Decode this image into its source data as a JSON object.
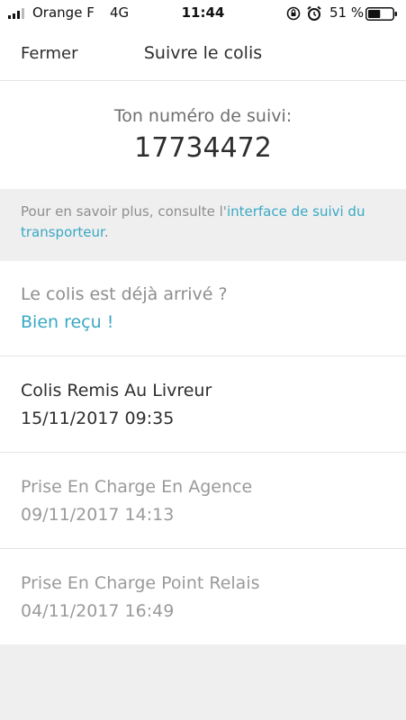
{
  "status_bar": {
    "carrier": "Orange F",
    "network": "4G",
    "time": "11:44",
    "battery_percent": "51 %",
    "battery_level": 0.51,
    "icons": [
      "signal-icon",
      "rotation-lock-icon",
      "alarm-icon",
      "battery-icon"
    ]
  },
  "nav": {
    "close_label": "Fermer",
    "title": "Suivre le colis"
  },
  "tracking": {
    "label": "Ton numéro de suivi:",
    "number": "17734472"
  },
  "info": {
    "text_before": "Pour en savoir plus, consulte l'",
    "link_text": "interface de suivi du transporteur",
    "text_after": "."
  },
  "received": {
    "question": "Le colis est déjà arrivé ?",
    "action_label": "Bien reçu !"
  },
  "events": [
    {
      "status": "Colis Remis Au Livreur",
      "date": "15/11/2017 09:35",
      "state": "current"
    },
    {
      "status": "Prise En Charge En Agence",
      "date": "09/11/2017 14:13",
      "state": "past"
    },
    {
      "status": "Prise En Charge Point Relais",
      "date": "04/11/2017 16:49",
      "state": "past"
    }
  ],
  "colors": {
    "accent": "#3aa8c2",
    "text_primary": "#2e2e2e",
    "text_muted": "#9a9a9a",
    "background_grey": "#efeff0"
  }
}
